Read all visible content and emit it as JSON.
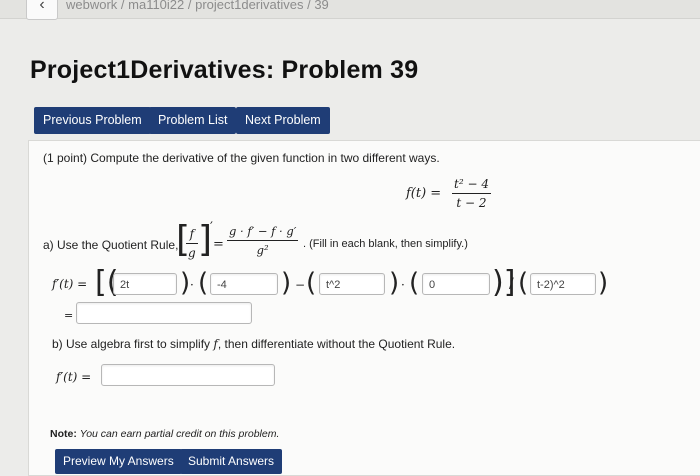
{
  "breadcrumb": {
    "back_glyph": "‹",
    "path": "webwork / ma110i22 / project1derivatives / 39"
  },
  "page_title": "Project1Derivatives: Problem 39",
  "nav": {
    "previous": "Previous Problem",
    "list": "Problem List",
    "next": "Next Problem"
  },
  "problem": {
    "intro": "(1 point) Compute the derivative of the given function in two different ways.",
    "function": {
      "lhs": "f(t) =",
      "numerator": "t² − 4",
      "denominator": "t − 2"
    },
    "part_a": {
      "label": "a) Use the Quotient Rule,",
      "rule_lhs_num": "f",
      "rule_lhs_den": "g",
      "rule_prime": "′",
      "rule_rhs_num": "g · f′ − f · g′",
      "rule_rhs_den": "g²",
      "hint": ". (Fill in each blank, then simplify.)",
      "fprime_label": "f′(t) =",
      "equals": "=",
      "answers": [
        "2t",
        "-4",
        "t^2",
        "0",
        "t-2)^2",
        ""
      ]
    },
    "part_b": {
      "label_pre": "b) Use algebra first to simplify ",
      "label_f": "f",
      "label_post": ", then differentiate without the Quotient Rule.",
      "fprime_label": "f′(t) =",
      "answer": ""
    }
  },
  "note": {
    "bold": "Note:",
    "text": "You can earn partial credit on this problem."
  },
  "buttons": {
    "preview": "Preview My Answers",
    "submit": "Submit Answers"
  },
  "colors": {
    "button_bg": "#1f3d76",
    "page_bg": "#ececea"
  }
}
